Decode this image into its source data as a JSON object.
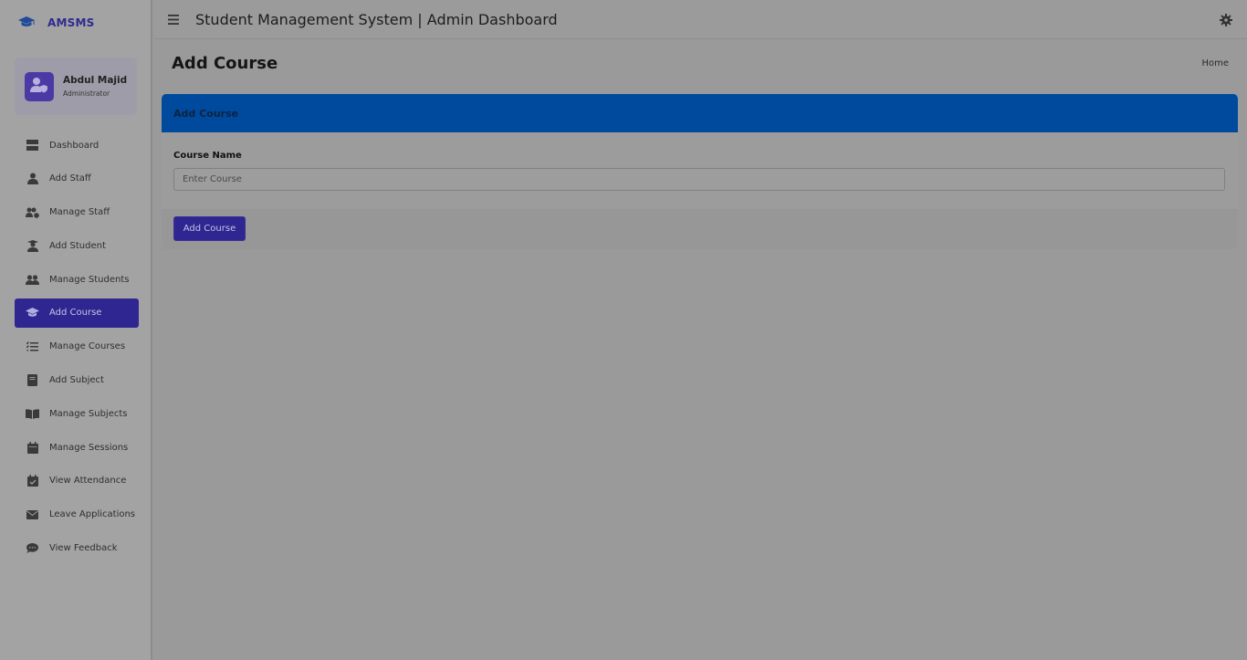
{
  "brand": {
    "name": "AMSMS",
    "icon": "graduation-cap-icon"
  },
  "user": {
    "name": "Abdul Majid",
    "role": "Administrator",
    "icon": "user-shield-icon"
  },
  "sidebar": {
    "items": [
      {
        "label": "Dashboard",
        "icon": "dashboard-icon",
        "active": false
      },
      {
        "label": "Add Staff",
        "icon": "user-tie-icon",
        "active": false
      },
      {
        "label": "Manage Staff",
        "icon": "users-cog-icon",
        "active": false
      },
      {
        "label": "Add Student",
        "icon": "user-graduate-icon",
        "active": false
      },
      {
        "label": "Manage Students",
        "icon": "users-icon",
        "active": false
      },
      {
        "label": "Add Course",
        "icon": "graduation-cap-icon",
        "active": true
      },
      {
        "label": "Manage Courses",
        "icon": "list-check-icon",
        "active": false
      },
      {
        "label": "Add Subject",
        "icon": "book-icon",
        "active": false
      },
      {
        "label": "Manage Subjects",
        "icon": "book-open-icon",
        "active": false
      },
      {
        "label": "Manage Sessions",
        "icon": "calendar-icon",
        "active": false
      },
      {
        "label": "View Attendance",
        "icon": "calendar-check-icon",
        "active": false
      },
      {
        "label": "Leave Applications",
        "icon": "envelope-icon",
        "active": false
      },
      {
        "label": "View Feedback",
        "icon": "comment-icon",
        "active": false
      }
    ]
  },
  "header": {
    "title": "Student Management System | Admin Dashboard"
  },
  "page": {
    "title": "Add Course",
    "breadcrumb": "Home"
  },
  "form": {
    "header": "Add Course",
    "course_label": "Course Name",
    "course_placeholder": "Enter Course",
    "course_value": "",
    "submit_label": "Add Course"
  },
  "colors": {
    "accent": "#2f2691",
    "card_header": "#004a9e",
    "brand_text": "#2f2a8f"
  }
}
